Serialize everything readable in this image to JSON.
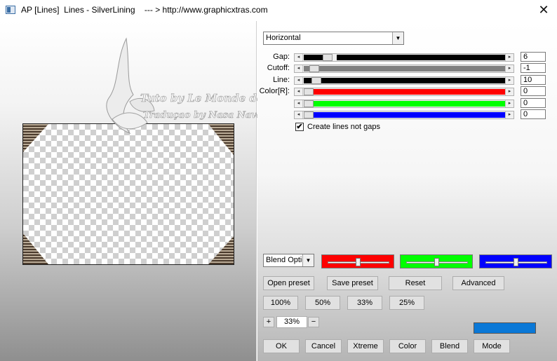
{
  "window": {
    "title": "AP [Lines]  Lines - SilverLining    --- > http://www.graphicxtras.com",
    "close_glyph": "✕"
  },
  "preview": {
    "watermark_line1": "Tuto by Le Monde de Bea",
    "watermark_line2": "Traduçao by Nasa Navas"
  },
  "direction": {
    "selected": "Horizontal"
  },
  "sliders": [
    {
      "label": "Gap:",
      "value": "6",
      "fill_color": "#000000",
      "fill_fraction": 0.1,
      "thumb_fraction": 0.1
    },
    {
      "label": "Cutoff:",
      "value": "-1",
      "fill_color": "#808080",
      "fill_fraction": 1.0,
      "thumb_fraction": 0.03
    },
    {
      "label": "Line:",
      "value": "10",
      "fill_color": "#000000",
      "fill_fraction": 1.0,
      "thumb_fraction": 0.04
    },
    {
      "label": "Color[R]:",
      "value": "0",
      "fill_color": "#ff0000",
      "fill_fraction": 1.0,
      "thumb_fraction": 0.0
    },
    {
      "label": "",
      "value": "0",
      "fill_color": "#00ff00",
      "fill_fraction": 1.0,
      "thumb_fraction": 0.0
    },
    {
      "label": "",
      "value": "0",
      "fill_color": "#0000ff",
      "fill_fraction": 1.0,
      "thumb_fraction": 0.0
    }
  ],
  "checkbox": {
    "label": "Create lines not gaps",
    "checked": true,
    "check_glyph": "✔"
  },
  "blend": {
    "selected": "Blend Options",
    "channels": [
      {
        "color": "#ff0000",
        "level": 0.5
      },
      {
        "color": "#00ff00",
        "level": 0.5
      },
      {
        "color": "#0000ff",
        "level": 0.5
      }
    ]
  },
  "preset_buttons": {
    "open": "Open preset",
    "save": "Save preset",
    "reset": "Reset",
    "advanced": "Advanced"
  },
  "zoom_buttons": [
    "100%",
    "50%",
    "33%",
    "25%"
  ],
  "zoom": {
    "plus": "+",
    "value": "33%",
    "minus": "−"
  },
  "output_color": "#0a78d7",
  "bottom_buttons": {
    "ok": "OK",
    "cancel": "Cancel",
    "xtreme": "Xtreme",
    "color": "Color",
    "blend": "Blend",
    "mode": "Mode"
  }
}
